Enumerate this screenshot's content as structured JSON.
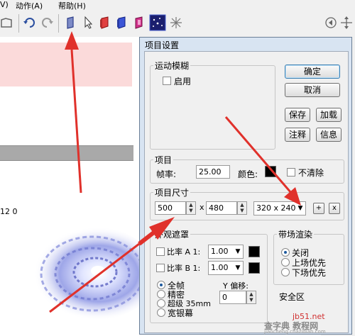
{
  "menu": {
    "items": [
      "V)",
      "动作(A)",
      "帮助(H)"
    ]
  },
  "left_pane": {
    "timeline_text": "12 0"
  },
  "dialog": {
    "title": "项目设置",
    "motion_blur": {
      "legend": "运动模糊",
      "enable_label": "启用",
      "enabled": false
    },
    "buttons": {
      "ok": "确定",
      "cancel": "取消",
      "save": "保存",
      "load": "加载",
      "comment": "注释",
      "info": "信息"
    },
    "project": {
      "legend": "项目",
      "frame_rate_label": "帧率:",
      "frame_rate": "25.00",
      "color_label": "颜色:",
      "no_clear_label": "不清除"
    },
    "project_size": {
      "legend": "项目尺寸",
      "width": "500",
      "x_label": "x",
      "height": "480",
      "preset": "320 x 240",
      "add_button": "+",
      "remove_button": "x"
    },
    "appearance": {
      "legend": "外观遮罩",
      "ratio_a_label": "比率 A 1:",
      "ratio_a_value": "1.00",
      "ratio_b_label": "比率 B 1:",
      "ratio_b_value": "1.00",
      "options": [
        "全帧",
        "精密",
        "超级 35mm",
        "宽银幕"
      ],
      "selected": "全帧",
      "y_offset_label": "Y 偏移:",
      "y_offset": "0"
    },
    "transition": {
      "legend": "带场渲染",
      "options": [
        "关闭",
        "上场优先",
        "下场优先"
      ],
      "selected": "关闭"
    },
    "safe_area_partial": "安全区"
  },
  "watermark": {
    "line1": "查字典 教程网",
    "line2": "jiaocheng.chazidian.com",
    "site": "jb51.net"
  },
  "colors": {
    "arrow": "#e0312b",
    "pink": "#fbdada",
    "dialog_border": "#d8e4f2"
  }
}
